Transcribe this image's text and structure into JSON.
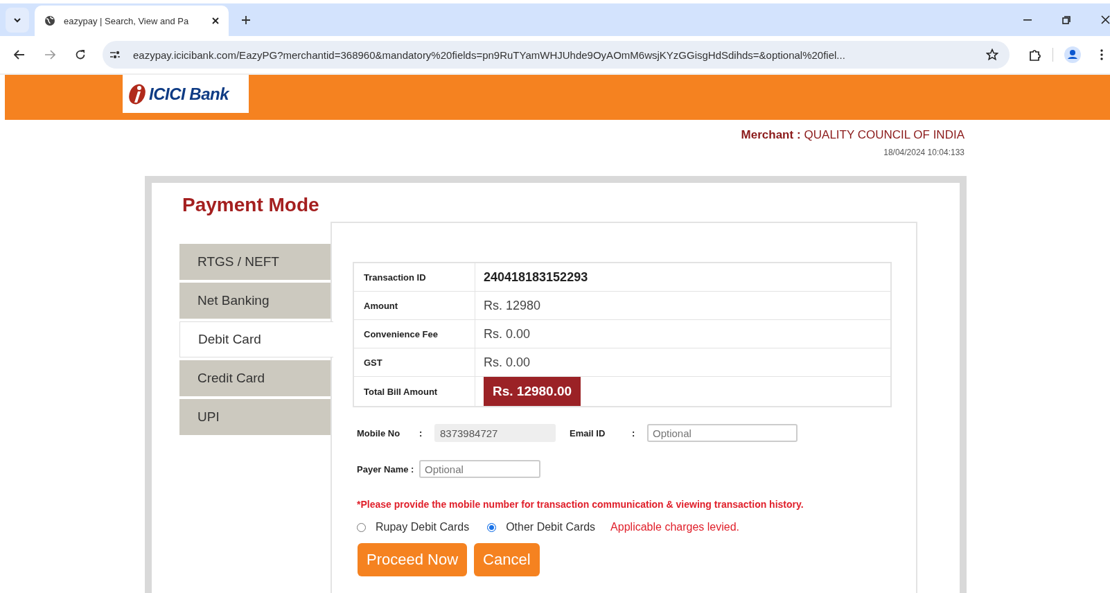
{
  "browser": {
    "tab_title": "eazypay | Search, View and Pa",
    "url": "eazypay.icicibank.com/EazyPG?merchantid=368960&mandatory%20fields=pn9RuTYamWHJUhde9OyAOmM6wsjKYzGGisgHdSdihds=&optional%20fiel..."
  },
  "header": {
    "logo_text": "ICICI Bank"
  },
  "merchant": {
    "label": "Merchant :",
    "name": "QUALITY COUNCIL OF INDIA",
    "timestamp": "18/04/2024 10:04:133"
  },
  "title": "Payment Mode",
  "modes": [
    {
      "label": "RTGS / NEFT",
      "selected": false
    },
    {
      "label": "Net Banking",
      "selected": false
    },
    {
      "label": "Debit Card",
      "selected": true
    },
    {
      "label": "Credit Card",
      "selected": false
    },
    {
      "label": "UPI",
      "selected": false
    }
  ],
  "summary": [
    {
      "label": "Transaction ID",
      "value": "240418183152293",
      "kind": "bold"
    },
    {
      "label": "Amount",
      "value": "Rs. 12980",
      "kind": "plain"
    },
    {
      "label": "Convenience Fee",
      "value": "Rs. 0.00",
      "kind": "plain"
    },
    {
      "label": "GST",
      "value": "Rs. 0.00",
      "kind": "plain"
    },
    {
      "label": "Total Bill Amount",
      "value": "Rs. 12980.00",
      "kind": "total"
    }
  ],
  "fields": [
    {
      "label": "Mobile No",
      "colon": ":",
      "value": "8373984727",
      "disabled": true
    },
    {
      "label": "Email ID",
      "colon": ":",
      "placeholder": "Optional",
      "disabled": false
    },
    {
      "label": "Payer Name :",
      "placeholder": "Optional",
      "disabled": false
    }
  ],
  "note": "*Please provide the mobile number for transaction communication & viewing transaction history.",
  "card_types": [
    {
      "label": "Rupay Debit Cards",
      "selected": false
    },
    {
      "label": "Other Debit Cards",
      "selected": true
    }
  ],
  "charges_note": "Applicable charges levied.",
  "buttons": [
    "Proceed Now",
    "Cancel"
  ]
}
